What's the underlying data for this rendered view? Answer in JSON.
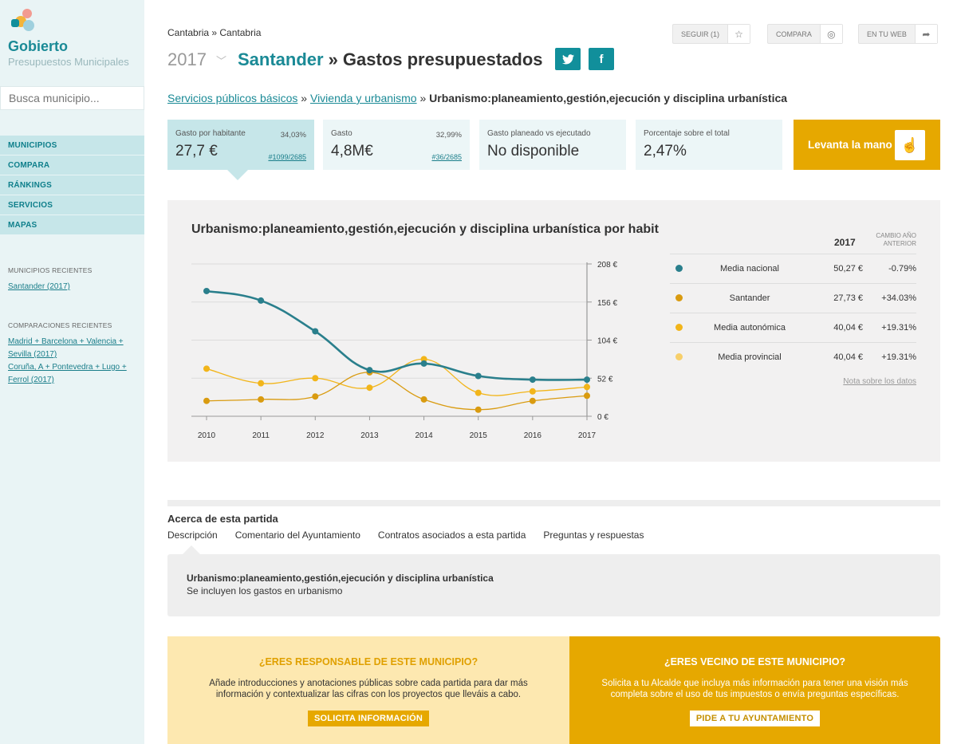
{
  "brand": {
    "title": "Gobierto",
    "subtitle": "Presupuestos Municipales"
  },
  "search": {
    "placeholder": "Busca municipio..."
  },
  "nav": [
    "MUNICIPIOS",
    "COMPARA",
    "RÁNKINGS",
    "SERVICIOS",
    "MAPAS"
  ],
  "recent": {
    "munis_heading": "MUNICIPIOS RECIENTES",
    "munis": [
      "Santander (2017)"
    ],
    "comps_heading": "COMPARACIONES RECIENTES",
    "comps": [
      "Madrid + Barcelona + Valencia + Sevilla (2017)",
      "Coruña, A + Pontevedra + Lugo + Ferrol (2017)"
    ]
  },
  "header": {
    "breadcrumb": "Cantabria » Cantabria",
    "year": "2017",
    "municipality": "Santander",
    "page_title": "» Gastos presupuestados",
    "follow": "SEGUIR (1)",
    "compare": "COMPARA",
    "web": "EN TU WEB"
  },
  "path": {
    "l1": "Servicios públicos básicos",
    "sep1": " » ",
    "l2": "Vivienda y urbanismo",
    "sep2": " » ",
    "current": "Urbanismo:planeamiento,gestión,ejecución y disciplina urbanística"
  },
  "kpis": [
    {
      "label": "Gasto por habitante",
      "pct": "34,03%",
      "value": "27,7 €",
      "rank": "#1099/2685"
    },
    {
      "label": "Gasto",
      "pct": "32,99%",
      "value": "4,8M€",
      "rank": "#36/2685"
    },
    {
      "label": "Gasto planeado vs ejecutado",
      "value": "No disponible"
    },
    {
      "label": "Porcentaje sobre el total",
      "value": "2,47%"
    }
  ],
  "raise_hand": "Levanta la mano",
  "colors": {
    "teal": "#2a7f8c",
    "dark_gold": "#d99b10",
    "gold": "#f2b51a",
    "light_gold": "#f7cf6a"
  },
  "chart_data": {
    "type": "line",
    "title": "Urbanismo:planeamiento,gestión,ejecución y disciplina urbanística por habit",
    "x": [
      "2010",
      "2011",
      "2012",
      "2013",
      "2014",
      "2015",
      "2016",
      "2017"
    ],
    "y_ticks": [
      "208 €",
      "156 €",
      "104 €",
      "52 €",
      "0 €"
    ],
    "ylim": [
      0,
      208
    ],
    "series": [
      {
        "name": "Media nacional",
        "color": "#2a7f8c",
        "values": [
          171,
          158,
          116,
          63,
          72,
          55,
          50,
          50
        ]
      },
      {
        "name": "Santander",
        "color": "#d99b10",
        "values": [
          21,
          23,
          27,
          60,
          23,
          9,
          21,
          28
        ]
      },
      {
        "name": "Media autonómica",
        "color": "#f2b51a",
        "values": [
          65,
          45,
          52,
          39,
          78,
          32,
          34,
          40
        ]
      }
    ]
  },
  "legend": {
    "year": "2017",
    "change": "CAMBIO AÑO ANTERIOR",
    "rows": [
      {
        "name": "Media nacional",
        "value": "50,27 €",
        "change": "-0.79%",
        "color": "#2a7f8c"
      },
      {
        "name": "Santander",
        "value": "27,73 €",
        "change": "+34.03%",
        "color": "#d99b10"
      },
      {
        "name": "Media autonómica",
        "value": "40,04 €",
        "change": "+19.31%",
        "color": "#f2b51a"
      },
      {
        "name": "Media provincial",
        "value": "40,04 €",
        "change": "+19.31%",
        "color": "#f7cf6a"
      }
    ],
    "note": "Nota sobre los datos"
  },
  "about": {
    "heading": "Acerca de esta partida",
    "tabs": [
      "Descripción",
      "Comentario del Ayuntamiento",
      "Contratos asociados a esta partida",
      "Preguntas y respuestas"
    ],
    "desc_title": "Urbanismo:planeamiento,gestión,ejecución y disciplina urbanística",
    "desc_text": "Se incluyen los gastos en urbanismo"
  },
  "cta": {
    "left_title": "¿ERES RESPONSABLE DE ESTE MUNICIPIO?",
    "left_text": "Añade introducciones y anotaciones públicas sobre cada partida para dar más información y contextualizar las cifras con los proyectos que lleváis a cabo.",
    "left_button": "SOLICITA INFORMACIÓN",
    "right_title": "¿ERES VECINO DE ESTE MUNICIPIO?",
    "right_text": "Solicita a tu Alcalde que incluya más información para tener una visión más completa sobre el uso de tus impuestos o envía preguntas específicas.",
    "right_button": "PIDE A TU AYUNTAMIENTO"
  }
}
